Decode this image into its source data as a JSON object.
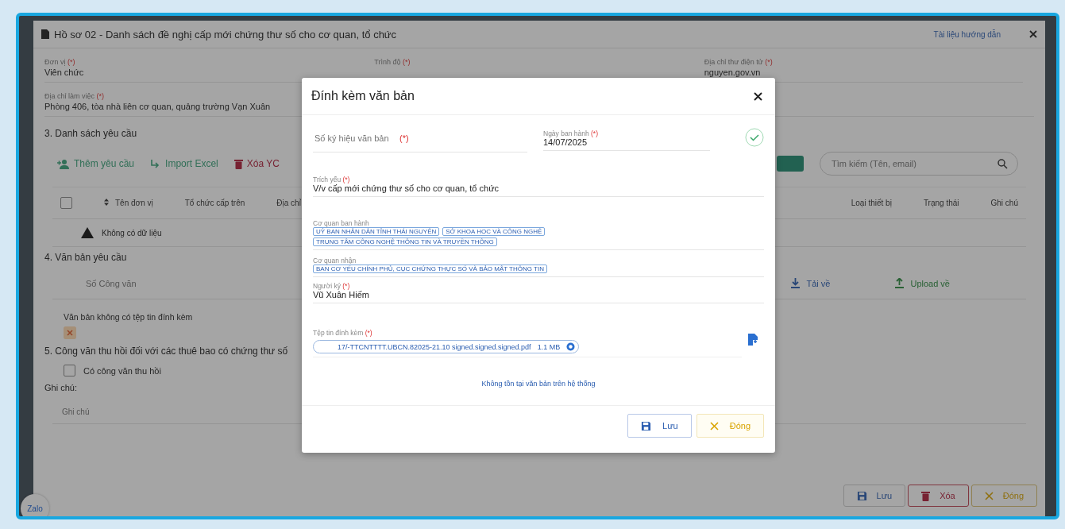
{
  "window": {
    "title": "Hồ sơ 02 - Danh sách đề nghị cấp mới chứng thư số cho cơ quan, tổ chức",
    "help_link": "Tài liệu hướng dẫn"
  },
  "top_fields": [
    {
      "label": "Đơn vị",
      "required_mark": "(*)",
      "value": "Viên chức"
    },
    {
      "label": "Trình độ",
      "required_mark": "(*)"
    },
    {
      "label": "Địa chỉ thư điện tử",
      "required_mark": "(*)",
      "value": "nguyen.gov.vn"
    }
  ],
  "address": {
    "label": "Địa chỉ làm việc",
    "required_mark": "(*)",
    "value": "Phòng 406, tòa nhà liên cơ quan, quảng trường Vạn Xuân"
  },
  "section_3": {
    "heading": "3. Danh sách yêu cầu",
    "toolbar": [
      {
        "kind": "add",
        "label": "Thêm yêu cầu"
      },
      {
        "kind": "import",
        "label": "Import Excel"
      },
      {
        "kind": "delete",
        "label": "Xóa YC"
      }
    ],
    "search": {
      "placeholder": "Tìm kiếm (Tên, email)"
    },
    "columns": [
      "Tên đơn vị",
      "Tổ chức cấp trên",
      "Địa chỉ",
      "Loại thiết bị",
      "Trạng thái",
      "Ghi chú"
    ],
    "select_all": {
      "checked": false
    },
    "empty": "Không có dữ liệu"
  },
  "section_4": {
    "heading": "4. Văn bản yêu cầu",
    "number_field": {
      "placeholder": "Số Công văn"
    },
    "download": "Tải về",
    "upload": "Upload về",
    "no_file": "Văn bản không có tệp tin đính kèm"
  },
  "section_5": {
    "heading": "5. Công văn thu hồi đối với các thuê bao có chứng thư số",
    "revoke": {
      "label": "Có công văn thu hồi",
      "checked": false
    }
  },
  "note": {
    "label": "Ghi chú:",
    "placeholder": "Ghi chú"
  },
  "footer_buttons": [
    {
      "kind": "save",
      "label": "Lưu"
    },
    {
      "kind": "delete",
      "label": "Xóa"
    },
    {
      "kind": "close",
      "label": "Đóng"
    }
  ],
  "chat_bubble": "Zalo",
  "modal": {
    "title": "Đính kèm văn bản",
    "number": {
      "placeholder": "Số ký hiệu văn bản",
      "required_mark": "(*)"
    },
    "date": {
      "label": "Ngày ban hành",
      "required_mark": "(*)",
      "value": "14/07/2025"
    },
    "summary": {
      "label": "Trích yếu",
      "required_mark": "(*)",
      "value": "V/v cấp mới chứng thư số cho cơ quan, tổ chức"
    },
    "issuers": {
      "label": "Cơ quan ban hành",
      "tags": [
        "UỶ BAN NHÂN DÂN TỈNH THÁI NGUYÊN",
        "SỞ KHOA HỌC VÀ CÔNG NGHỆ",
        "TRUNG TÂM CÔNG NGHỆ THÔNG TIN VÀ TRUYỀN THÔNG"
      ]
    },
    "receivers": {
      "label": "Cơ quan nhận",
      "tags": [
        "BAN CƠ YẾU CHÍNH PHỦ, CỤC CHỨNG THỰC SỐ VÀ BẢO MẬT THÔNG TIN"
      ]
    },
    "signer": {
      "label": "Người ký",
      "required_mark": "(*)",
      "value": "Vũ Xuân Hiếm"
    },
    "attachment": {
      "label": "Tệp tin đính kèm",
      "required_mark": "(*)",
      "file": "17/-TTCNTTTT.UBCN.82025-21.10 signed.signed.signed.pdf",
      "size": "1.1 MB"
    },
    "status": "Không tồn tại văn bản trên hệ thống",
    "buttons": [
      {
        "kind": "save",
        "label": "Lưu"
      },
      {
        "kind": "close",
        "label": "Đóng"
      }
    ]
  }
}
